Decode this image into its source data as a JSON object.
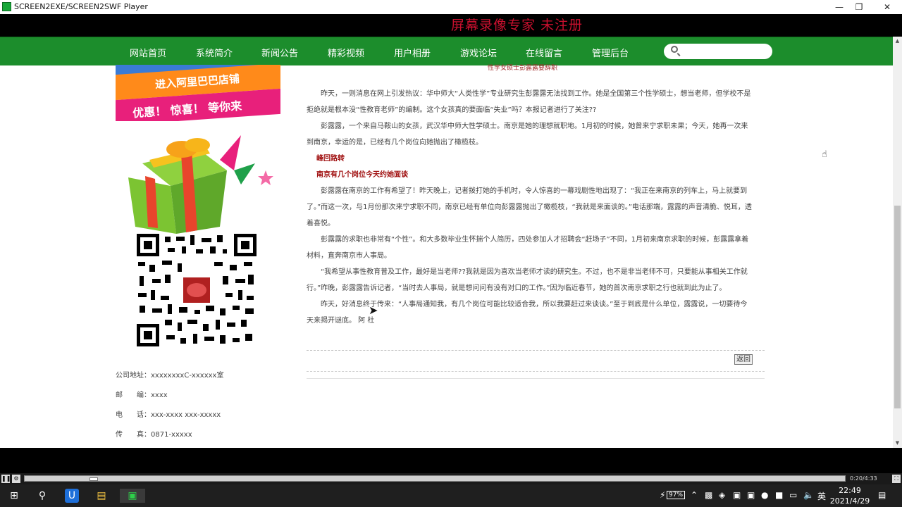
{
  "window": {
    "title": "SCREEN2EXE/SCREEN2SWF Player",
    "watermark": "屏幕录像专家  未注册"
  },
  "nav": {
    "items": [
      {
        "label": "网站首页"
      },
      {
        "label": "系统简介"
      },
      {
        "label": "新闻公告"
      },
      {
        "label": "精彩视频"
      },
      {
        "label": "用户相册"
      },
      {
        "label": "游戏论坛"
      },
      {
        "label": "在线留言"
      },
      {
        "label": "管理后台"
      }
    ],
    "search": {
      "value": "",
      "placeholder": ""
    }
  },
  "sidebar": {
    "banner_line1": "进入阿里巴巴店铺",
    "banner_line2": "优惠！ 惊喜！ 等你来",
    "contact": {
      "address": "公司地址：xxxxxxxxC-xxxxxx室",
      "postcode": "邮　　编：xxxx",
      "phone": "电　　话：xxx-xxxx xxx-xxxxx",
      "fax": "传　　真：0871-xxxxx"
    }
  },
  "article": {
    "top_line": "性学女硕士彭露露要辞职",
    "paragraphs": [
      {
        "type": "body",
        "text": "昨天，一则消息在网上引发热议：华中师大“人类性学”专业研究生彭露露无法找到工作。她是全国第三个性学硕士，想当老师，但学校不是拒绝就是根本没“性教育老师”的编制。这个女孩真的要面临“失业”吗？本报记者进行了关注??"
      },
      {
        "type": "body",
        "text": "彭露露，一个来自马鞍山的女孩，武汉华中师大性学硕士。南京是她的理想就职地。1月初的时候，她曾来宁求职未果；今天，她再一次来到南京，幸运的是，已经有几个岗位向她抛出了橄榄枝。"
      },
      {
        "type": "sub",
        "text": "峰回路转"
      },
      {
        "type": "sub",
        "text": "南京有几个岗位今天约她面谈"
      },
      {
        "type": "body",
        "text": "彭露露在南京的工作有希望了！昨天晚上，记者拨打她的手机时，令人惊喜的一幕戏剧性地出现了：“我正在来南京的列车上，马上就要到了。”而这一次，与1月份那次来宁求职不同，南京已经有单位向彭露露抛出了橄榄枝，“我就是来面谈的。”电话那端，露露的声音清脆、悦耳，透着喜悦。"
      },
      {
        "type": "body",
        "text": "彭露露的求职也非常有“个性”。和大多数毕业生怀揣个人简历，四处参加人才招聘会“赶场子”不同，1月初来南京求职的时候，彭露露拿着材料，直奔南京市人事局。"
      },
      {
        "type": "body",
        "text": "“我希望从事性教育普及工作，最好是当老师??我就是因为喜欢当老师才读的研究生。不过，也不是非当老师不可，只要能从事相关工作就行。”昨晚，彭露露告诉记者，“当时去人事局，就是想问问有没有对口的工作。”因为临近春节，她的首次南京求职之行也就到此为止了。"
      },
      {
        "type": "body",
        "text": "昨天，好消息终于传来：“人事局通知我，有几个岗位可能比较适合我，所以我要赶过来谈谈。”至于到底是什么单位，露露说，一切要待今天来揭开谜底。 阿 杜"
      }
    ],
    "back_label": "返回"
  },
  "player": {
    "time": "0:20/4:33",
    "progress": 0.08
  },
  "taskbar": {
    "battery": "97%",
    "ime": "英",
    "time": "22:49",
    "date": "2021/4/29"
  }
}
